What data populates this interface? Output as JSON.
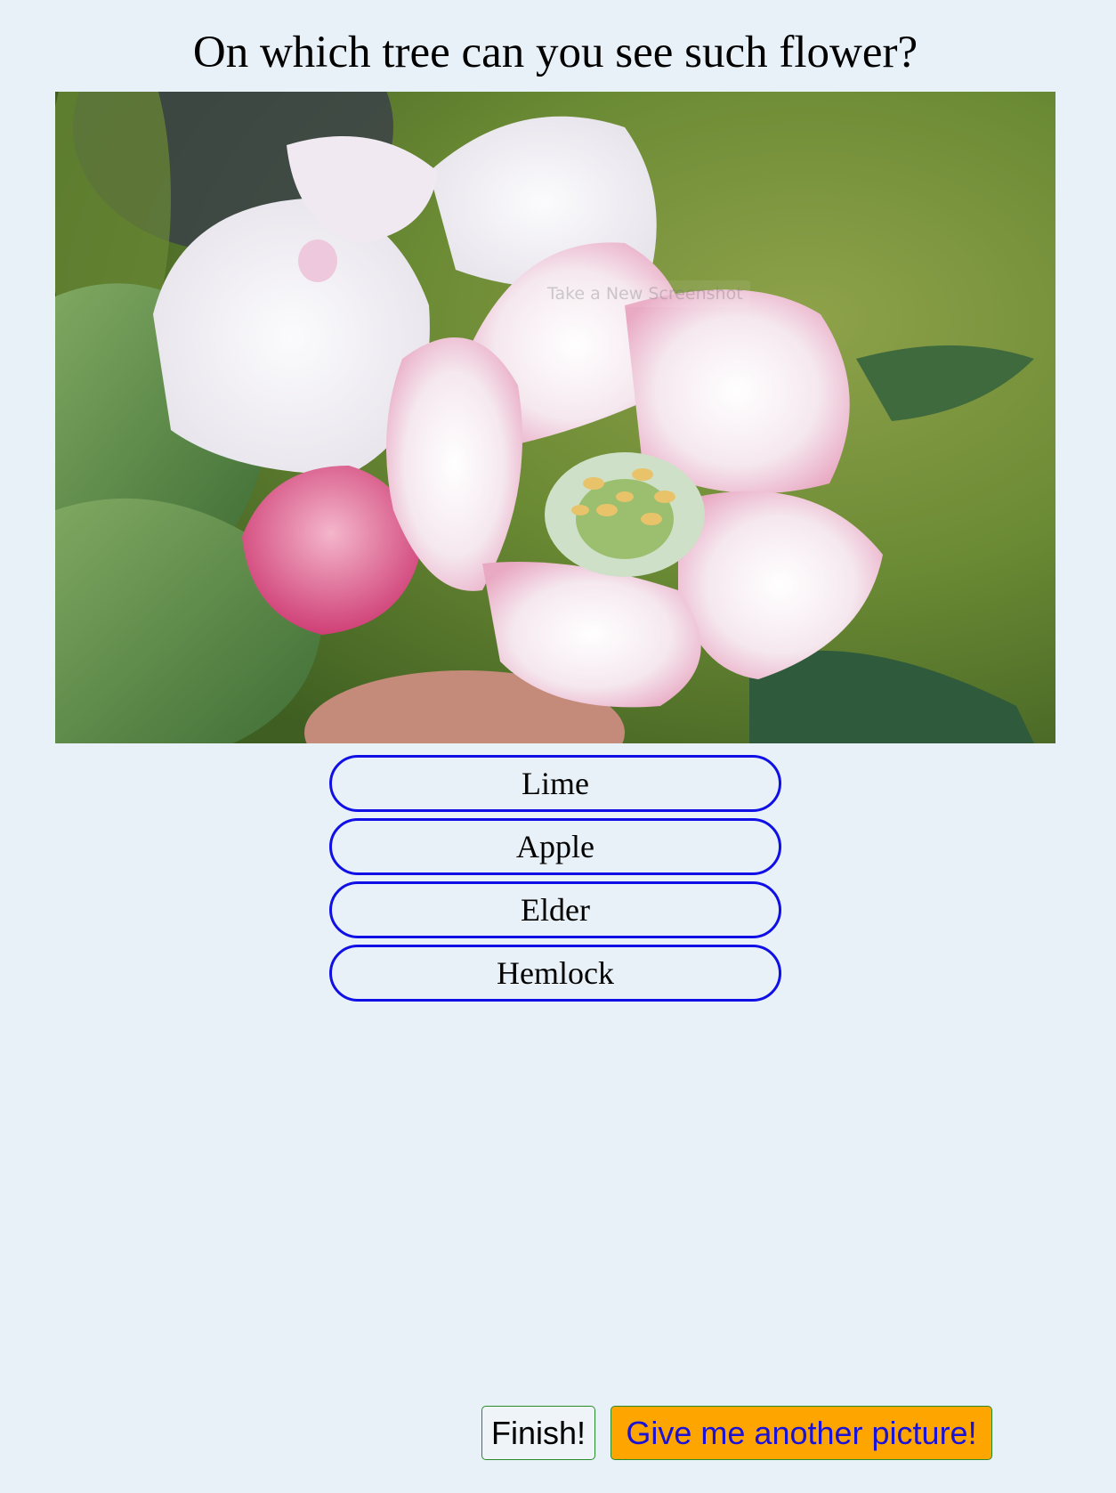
{
  "question": "On which tree can you see such flower?",
  "photo": {
    "overlay_text": "Take a New Screenshot",
    "subject": "pink-white apple blossom with green leaves"
  },
  "answers": [
    {
      "label": "Lime"
    },
    {
      "label": "Apple"
    },
    {
      "label": "Elder"
    },
    {
      "label": "Hemlock"
    }
  ],
  "buttons": {
    "finish_label": "Finish!",
    "another_label": "Give me another picture!"
  },
  "colors": {
    "background": "#e8f1f8",
    "answer_border": "#1010e6",
    "another_bg": "#ffa500",
    "another_text": "#1a12d6",
    "button_border": "#2a8a2a"
  }
}
